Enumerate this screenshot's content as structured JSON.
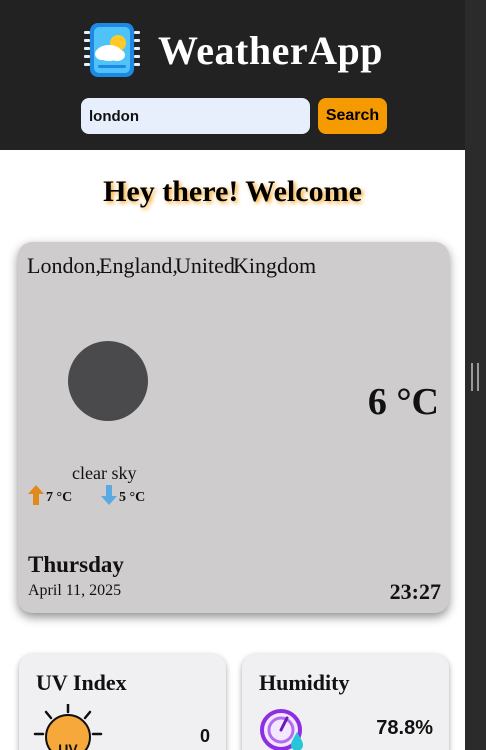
{
  "header": {
    "app_name": "WeatherApp",
    "logo_icon": "weather-app-logo-icon"
  },
  "search": {
    "value": "london",
    "placeholder": "",
    "button_label": "Search"
  },
  "welcome_text": "Hey there! Welcome",
  "current": {
    "location_parts": [
      "London,",
      "England,",
      "United",
      "Kingdom"
    ],
    "temperature": "6 °C",
    "description": "clear sky",
    "temp_max": "7 °C",
    "temp_min": "5 °C",
    "day": "Thursday",
    "date": "April 11, 2025",
    "time": "23:27",
    "icons": {
      "weather": "weather-placeholder-icon",
      "max": "arrow-up-icon",
      "min": "arrow-down-icon"
    }
  },
  "uv": {
    "title": "UV Index",
    "value": "0",
    "icon_label": "UV",
    "icon": "uv-sun-icon"
  },
  "humidity": {
    "title": "Humidity",
    "value": "78.8%",
    "icon": "humidity-gauge-icon"
  },
  "colors": {
    "header_bg": "#222222",
    "accent": "#f59a00",
    "card_bg": "#cfcccd",
    "arrow_up": "#e08a1e",
    "arrow_down": "#5aa9e0"
  }
}
